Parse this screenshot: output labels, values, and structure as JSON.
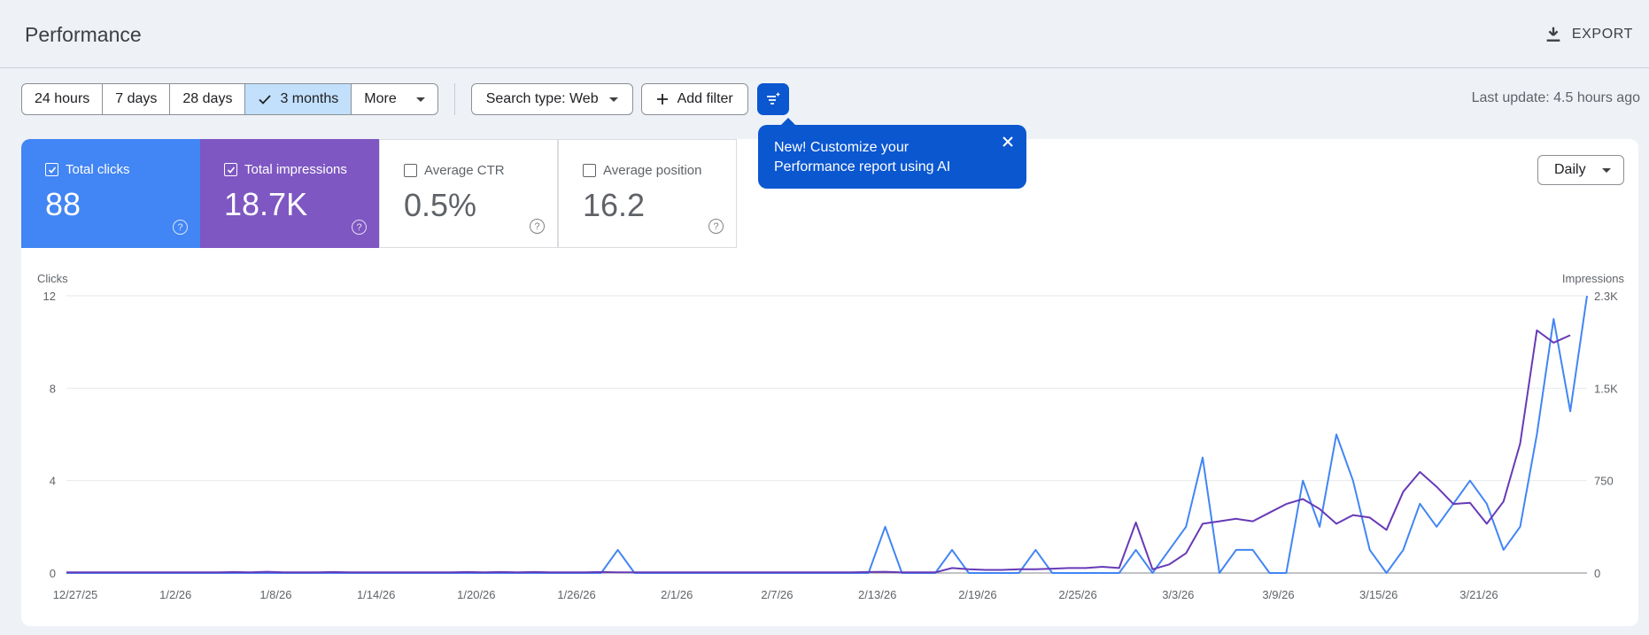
{
  "header": {
    "title": "Performance",
    "export_label": "EXPORT"
  },
  "toolbar": {
    "date_options": [
      "24 hours",
      "7 days",
      "28 days",
      "3 months",
      "More"
    ],
    "selected_date": "3 months",
    "search_type": "Search type: Web",
    "add_filter": "Add filter",
    "last_update": "Last update: 4.5 hours ago"
  },
  "metrics": [
    {
      "label": "Total clicks",
      "value": "88",
      "checked": true,
      "color": "#4285f4"
    },
    {
      "label": "Total impressions",
      "value": "18.7K",
      "checked": true,
      "color": "#7e57c2"
    },
    {
      "label": "Average CTR",
      "value": "0.5%",
      "checked": false
    },
    {
      "label": "Average position",
      "value": "16.2",
      "checked": false
    }
  ],
  "tooltip": {
    "text": "New! Customize your Performance report using AI"
  },
  "granularity": "Daily",
  "chart_data": {
    "type": "line",
    "left_axis": {
      "label": "Clicks",
      "ticks": [
        "12",
        "8",
        "4",
        "0"
      ],
      "ylim": [
        0,
        12
      ]
    },
    "right_axis": {
      "label": "Impressions",
      "ticks": [
        "2.3K",
        "1.5K",
        "750",
        "0"
      ],
      "ylim": [
        0,
        2250
      ]
    },
    "x_ticks": [
      "12/27/25",
      "1/2/26",
      "1/8/26",
      "1/14/26",
      "1/20/26",
      "1/26/26",
      "2/1/26",
      "2/7/26",
      "2/13/26",
      "2/19/26",
      "2/25/26",
      "3/3/26",
      "3/9/26",
      "3/15/26",
      "3/21/26"
    ],
    "x_start": "12/27/25",
    "series": [
      {
        "name": "Total clicks",
        "axis": "left",
        "color": "#4285f4",
        "values": [
          0,
          0,
          0,
          0,
          0,
          0,
          0,
          0,
          0,
          0,
          0,
          0,
          0,
          0,
          0,
          0,
          0,
          0,
          0,
          0,
          0,
          0,
          0,
          0,
          0,
          0,
          0,
          0,
          0,
          0,
          0,
          0,
          0,
          1,
          0,
          0,
          0,
          0,
          0,
          0,
          0,
          0,
          0,
          0,
          0,
          0,
          0,
          0,
          0,
          2,
          0,
          0,
          0,
          1,
          0,
          0,
          0,
          0,
          1,
          0,
          0,
          0,
          0,
          0,
          1,
          0,
          1,
          2,
          5,
          0,
          1,
          1,
          0,
          0,
          4,
          2,
          6,
          4,
          1,
          0,
          1,
          3,
          2,
          3,
          4,
          3,
          1,
          2,
          6,
          11,
          7,
          12
        ]
      },
      {
        "name": "Total impressions",
        "axis": "right",
        "color": "#673ab7",
        "values": [
          5,
          5,
          5,
          5,
          5,
          5,
          5,
          5,
          5,
          5,
          8,
          5,
          10,
          5,
          5,
          5,
          8,
          5,
          5,
          5,
          5,
          5,
          5,
          5,
          8,
          5,
          8,
          5,
          8,
          5,
          5,
          5,
          8,
          5,
          5,
          5,
          5,
          5,
          5,
          5,
          5,
          5,
          5,
          5,
          5,
          5,
          5,
          5,
          8,
          10,
          5,
          5,
          5,
          40,
          30,
          25,
          25,
          30,
          30,
          35,
          40,
          40,
          50,
          40,
          410,
          30,
          70,
          160,
          400,
          420,
          440,
          420,
          490,
          560,
          600,
          520,
          400,
          470,
          450,
          350,
          660,
          820,
          700,
          560,
          570,
          400,
          580,
          1050,
          1970,
          1870,
          1930
        ]
      }
    ]
  }
}
